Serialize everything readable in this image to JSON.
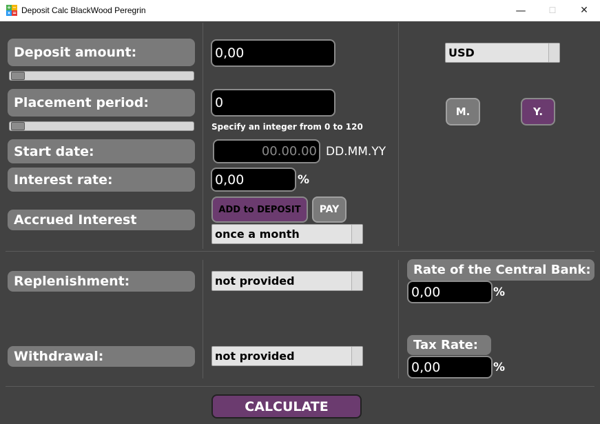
{
  "window": {
    "title": "Deposit Calc BlackWood Peregrin",
    "minimize": "—",
    "maximize": "☐",
    "close": "✕"
  },
  "left": {
    "deposit_amount_label": "Deposit amount:",
    "placement_period_label": "Placement period:",
    "start_date_label": "Start date:",
    "interest_rate_label": "Interest rate:",
    "accrued_interest_label": "Accrued Interest",
    "replenishment_label": "Replenishment:",
    "withdrawal_label": "Withdrawal:"
  },
  "sliders": {
    "deposit_amount_level": 0,
    "placement_period_level": 0
  },
  "inputs": {
    "deposit_amount": "0,00",
    "placement_period": "0",
    "placement_hint": "Specify an integer from 0 to 120",
    "start_date_placeholder": "00.00.00",
    "date_format": "DD.MM.YY",
    "interest_rate": "0,00",
    "interest_percent": "%"
  },
  "accrual": {
    "add_to_deposit": "ADD to DEPOSIT",
    "pay": "PAY",
    "frequency": "once a month"
  },
  "replenishment": {
    "value": "not provided"
  },
  "withdrawal": {
    "value": "not provided"
  },
  "right": {
    "currency": "USD",
    "months_button": "M.",
    "years_button": "Y.",
    "central_bank_label": "Rate of the Central Bank:",
    "central_bank_value": "0,00",
    "central_bank_percent": "%",
    "tax_rate_label": "Tax Rate:",
    "tax_rate_value": "0,00",
    "tax_percent": "%"
  },
  "actions": {
    "calculate": "CALCULATE"
  },
  "colors": {
    "background": "#424242",
    "pill": "#7a7a7a",
    "accent_purple": "#6b3b6f",
    "field": "#000000"
  }
}
